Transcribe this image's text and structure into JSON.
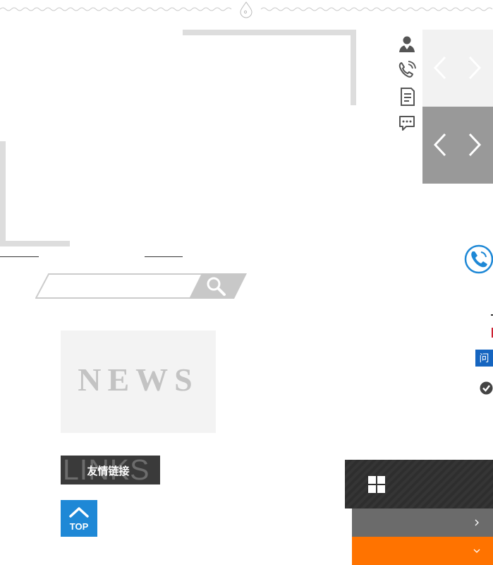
{
  "search": {
    "placeholder": "",
    "value": ""
  },
  "news_badge": {
    "text": "NEWS"
  },
  "links_badge": {
    "background_text": "LINKS",
    "label": "友情链接"
  },
  "top_button": {
    "label": "TOP"
  },
  "side_icons": [
    "person-icon",
    "phone-icon",
    "document-icon",
    "chat-icon"
  ],
  "ask_badge": {
    "text": "问"
  },
  "colors": {
    "accent_blue": "#1e88d6",
    "orange": "#ff7300",
    "dark": "#333333",
    "gray": "#6b6b6b",
    "light_gray": "#dddddd"
  }
}
